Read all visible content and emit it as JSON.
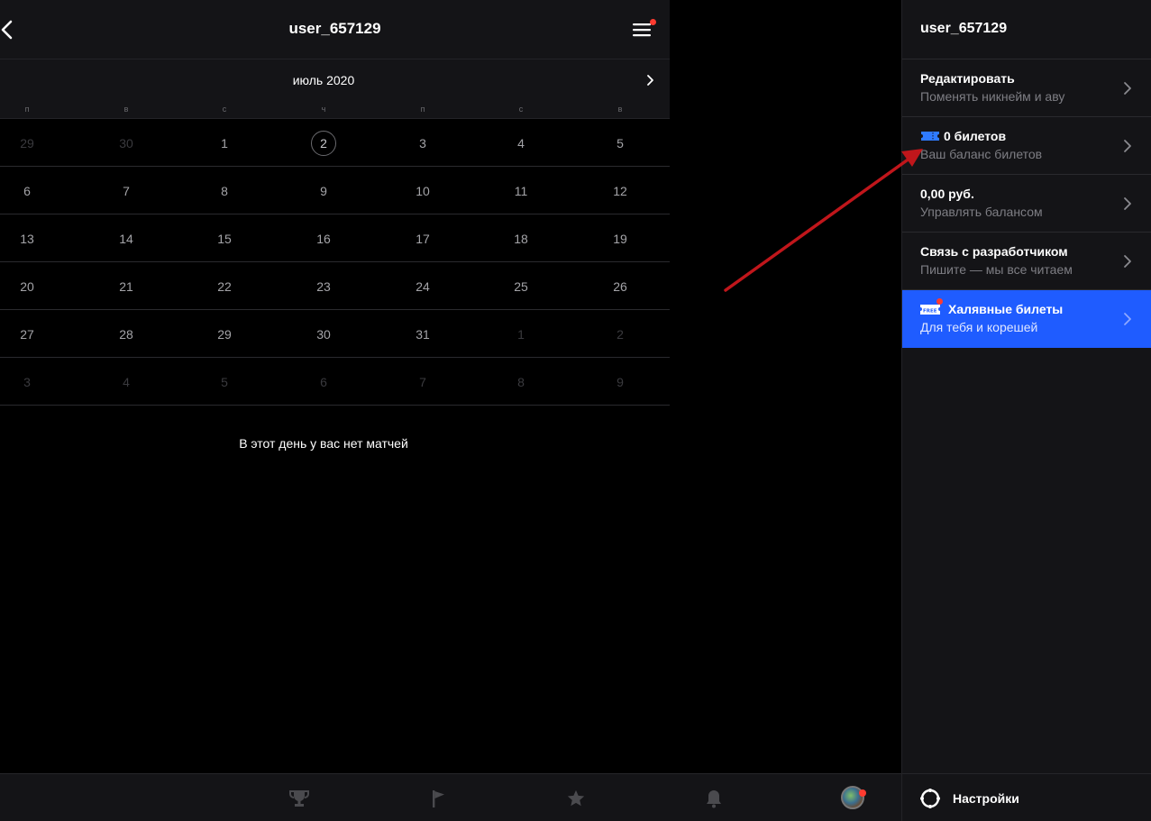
{
  "header": {
    "title": "user_657129"
  },
  "calendar": {
    "month": "июль 2020",
    "weekdays": [
      "п",
      "в",
      "с",
      "ч",
      "п",
      "с",
      "в"
    ],
    "weeks": [
      [
        {
          "d": "29",
          "muted": true
        },
        {
          "d": "30",
          "muted": true
        },
        {
          "d": "1"
        },
        {
          "d": "2",
          "selected": true
        },
        {
          "d": "3"
        },
        {
          "d": "4"
        },
        {
          "d": "5"
        }
      ],
      [
        {
          "d": "6"
        },
        {
          "d": "7"
        },
        {
          "d": "8"
        },
        {
          "d": "9"
        },
        {
          "d": "10"
        },
        {
          "d": "11"
        },
        {
          "d": "12"
        }
      ],
      [
        {
          "d": "13"
        },
        {
          "d": "14"
        },
        {
          "d": "15"
        },
        {
          "d": "16"
        },
        {
          "d": "17"
        },
        {
          "d": "18"
        },
        {
          "d": "19"
        }
      ],
      [
        {
          "d": "20"
        },
        {
          "d": "21"
        },
        {
          "d": "22"
        },
        {
          "d": "23"
        },
        {
          "d": "24"
        },
        {
          "d": "25"
        },
        {
          "d": "26"
        }
      ],
      [
        {
          "d": "27"
        },
        {
          "d": "28"
        },
        {
          "d": "29"
        },
        {
          "d": "30"
        },
        {
          "d": "31"
        },
        {
          "d": "1",
          "muted": true
        },
        {
          "d": "2",
          "muted": true
        }
      ],
      [
        {
          "d": "3",
          "muted": true
        },
        {
          "d": "4",
          "muted": true
        },
        {
          "d": "5",
          "muted": true
        },
        {
          "d": "6",
          "muted": true
        },
        {
          "d": "7",
          "muted": true
        },
        {
          "d": "8",
          "muted": true
        },
        {
          "d": "9",
          "muted": true
        }
      ]
    ],
    "empty_message": "В этот день у вас нет матчей"
  },
  "bottom_nav": {
    "icons": [
      "trophy-icon",
      "flag-icon",
      "star-icon",
      "bell-icon",
      "avatar"
    ]
  },
  "panel": {
    "username": "user_657129",
    "items": [
      {
        "title": "Редактировать",
        "subtitle": "Поменять никнейм и аву"
      },
      {
        "title": "0 билетов",
        "subtitle": "Ваш баланс билетов",
        "icon": "ticket-icon"
      },
      {
        "title": "0,00 руб.",
        "subtitle": "Управлять балансом"
      },
      {
        "title": "Связь с разработчиком",
        "subtitle": "Пишите — мы все читаем"
      },
      {
        "title": "Халявные билеты",
        "subtitle": "Для тебя и корешей",
        "icon": "free-ticket-icon"
      }
    ],
    "settings_label": "Настройки"
  },
  "colors": {
    "background": "#000000",
    "surface": "#141417",
    "accent_blue": "#1f5cff",
    "notification_red": "#ff3b30",
    "annotation_arrow": "#c0161b"
  }
}
